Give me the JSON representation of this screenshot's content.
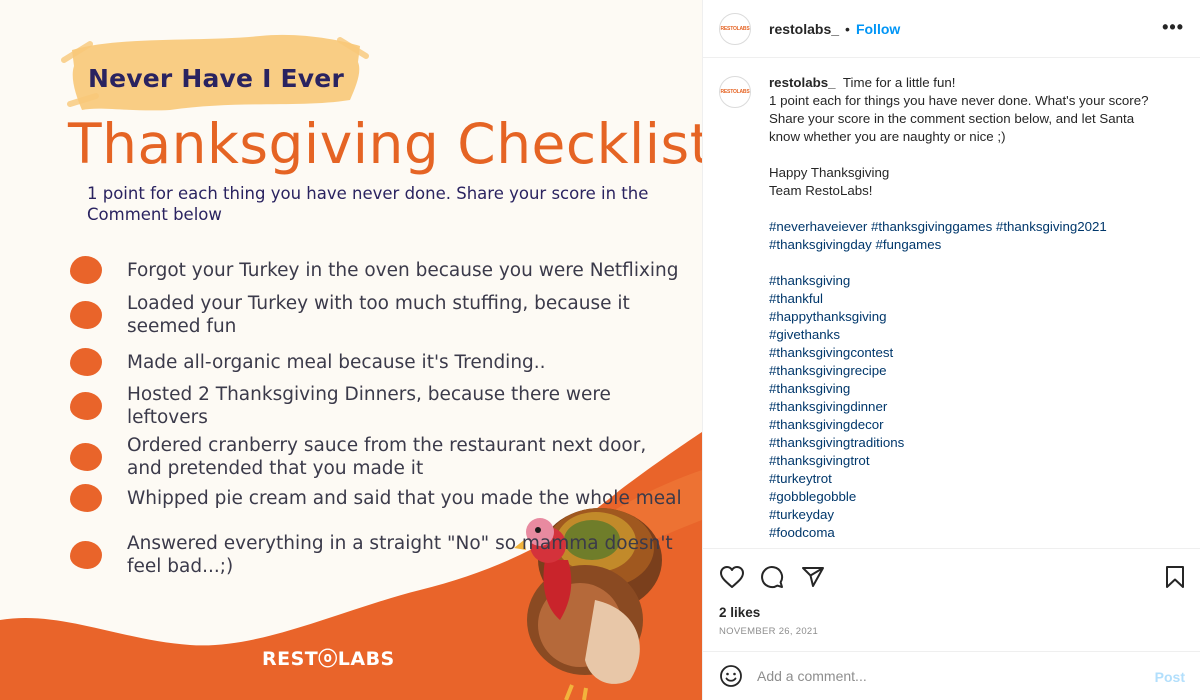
{
  "post_image": {
    "kicker": "Never Have I Ever",
    "headline": "Thanksgiving Checklist",
    "subline": "1 point for each thing you have never done. Share your score in the Comment below",
    "items": [
      "Forgot your Turkey in the oven because you were Netflixing",
      "Loaded your Turkey with too much stuffing, because it seemed fun",
      "Made all-organic meal because it's Trending..",
      "Hosted 2 Thanksgiving Dinners, because there were leftovers",
      "Ordered cranberry sauce from the restaurant next door, and pretended that you made it",
      "Whipped pie cream and said that you made the whole meal",
      "Answered everything in a straight \"No\" so mamma doesn't feel bad...;)"
    ],
    "brand": "RESTⓞLABS",
    "colors": {
      "accent_orange": "#e9642a",
      "navy": "#2a2360",
      "highlight": "#f9c97a",
      "background": "#fdfaf4"
    }
  },
  "header": {
    "username": "restolabs_",
    "separator": "•",
    "follow_label": "Follow",
    "more_label": "•••",
    "avatar_text": "RESTOLABS"
  },
  "caption": {
    "username": "restolabs_",
    "lines": [
      "Time for a little fun!",
      "1 point each for things you have never done. What's your score?",
      "Share your score in the comment section below, and let Santa",
      "know whether you are naughty or nice ;)",
      "",
      "Happy Thanksgiving",
      "Team RestoLabs!",
      ""
    ],
    "hashtag_lines": [
      "#neverhaveiever #thanksgivinggames #thanksgiving2021",
      "#thanksgivingday #fungames",
      "",
      "#thanksgiving",
      "#thankful",
      "#happythanksgiving",
      "#givethanks",
      "#thanksgivingcontest",
      "#thanksgivingrecipe",
      "#thanksgiving",
      "#thanksgivingdinner",
      "#thanksgivingdecor",
      "#thanksgivingtraditions",
      "#thanksgivingtrot",
      "#turkeytrot",
      "#gobblegobble",
      "#turkeyday",
      "#foodcoma"
    ]
  },
  "actions": {
    "icons": [
      "heart-icon",
      "comment-icon",
      "share-icon",
      "bookmark-icon"
    ],
    "likes": "2 likes",
    "date": "NOVEMBER 26, 2021"
  },
  "comment": {
    "placeholder": "Add a comment...",
    "post_label": "Post",
    "colors": {
      "link": "#0095f6",
      "hashtag": "#00376b",
      "post_disabled": "#b2dffc"
    }
  }
}
